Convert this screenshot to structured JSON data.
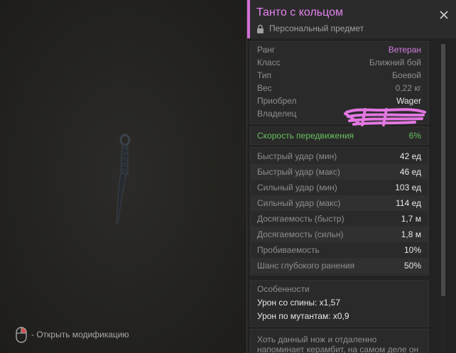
{
  "item": {
    "title": "Танто с кольцом",
    "subtitle": "Персональный предмет"
  },
  "info": [
    {
      "label": "Ранг",
      "value": "Ветеран",
      "style": "rank"
    },
    {
      "label": "Класс",
      "value": "Ближний бой",
      "style": "gray"
    },
    {
      "label": "Тип",
      "value": "Боевой",
      "style": "gray"
    },
    {
      "label": "Вес",
      "value": "0,22 кг",
      "style": "gray"
    },
    {
      "label": "Приобрел",
      "value": "Wager",
      "style": "white"
    },
    {
      "label": "Владелец",
      "value": "",
      "style": "gray"
    }
  ],
  "speed": {
    "label": "Скорость передвижения",
    "value": "6%"
  },
  "stats": [
    {
      "label": "Быстрый удар (мин)",
      "value": "42 ед"
    },
    {
      "label": "Быстрый удар (макс)",
      "value": "46 ед"
    },
    {
      "label": "Сильный удар (мин)",
      "value": "103 ед"
    },
    {
      "label": "Сильный удар (макс)",
      "value": "114 ед"
    },
    {
      "label": "Досягаемость (быстр)",
      "value": "1,7 м"
    },
    {
      "label": "Досягаемость (сильн)",
      "value": "1,8 м"
    },
    {
      "label": "Пробиваемость",
      "value": "10%"
    },
    {
      "label": "Шанс глубокого ранения",
      "value": "50%"
    }
  ],
  "features": {
    "title": "Особенности",
    "items": [
      "Урон со спины: x1,57",
      "Урон по мутантам: x0,9"
    ]
  },
  "description": "Хоть данный нож и отдаленно напоминает керамбит, на самом деле он",
  "hint": {
    "label": "- Открыть модификацию"
  },
  "colors": {
    "accent": "#d26fd6",
    "rank": "#d27fe0",
    "speed": "#68c25e"
  }
}
